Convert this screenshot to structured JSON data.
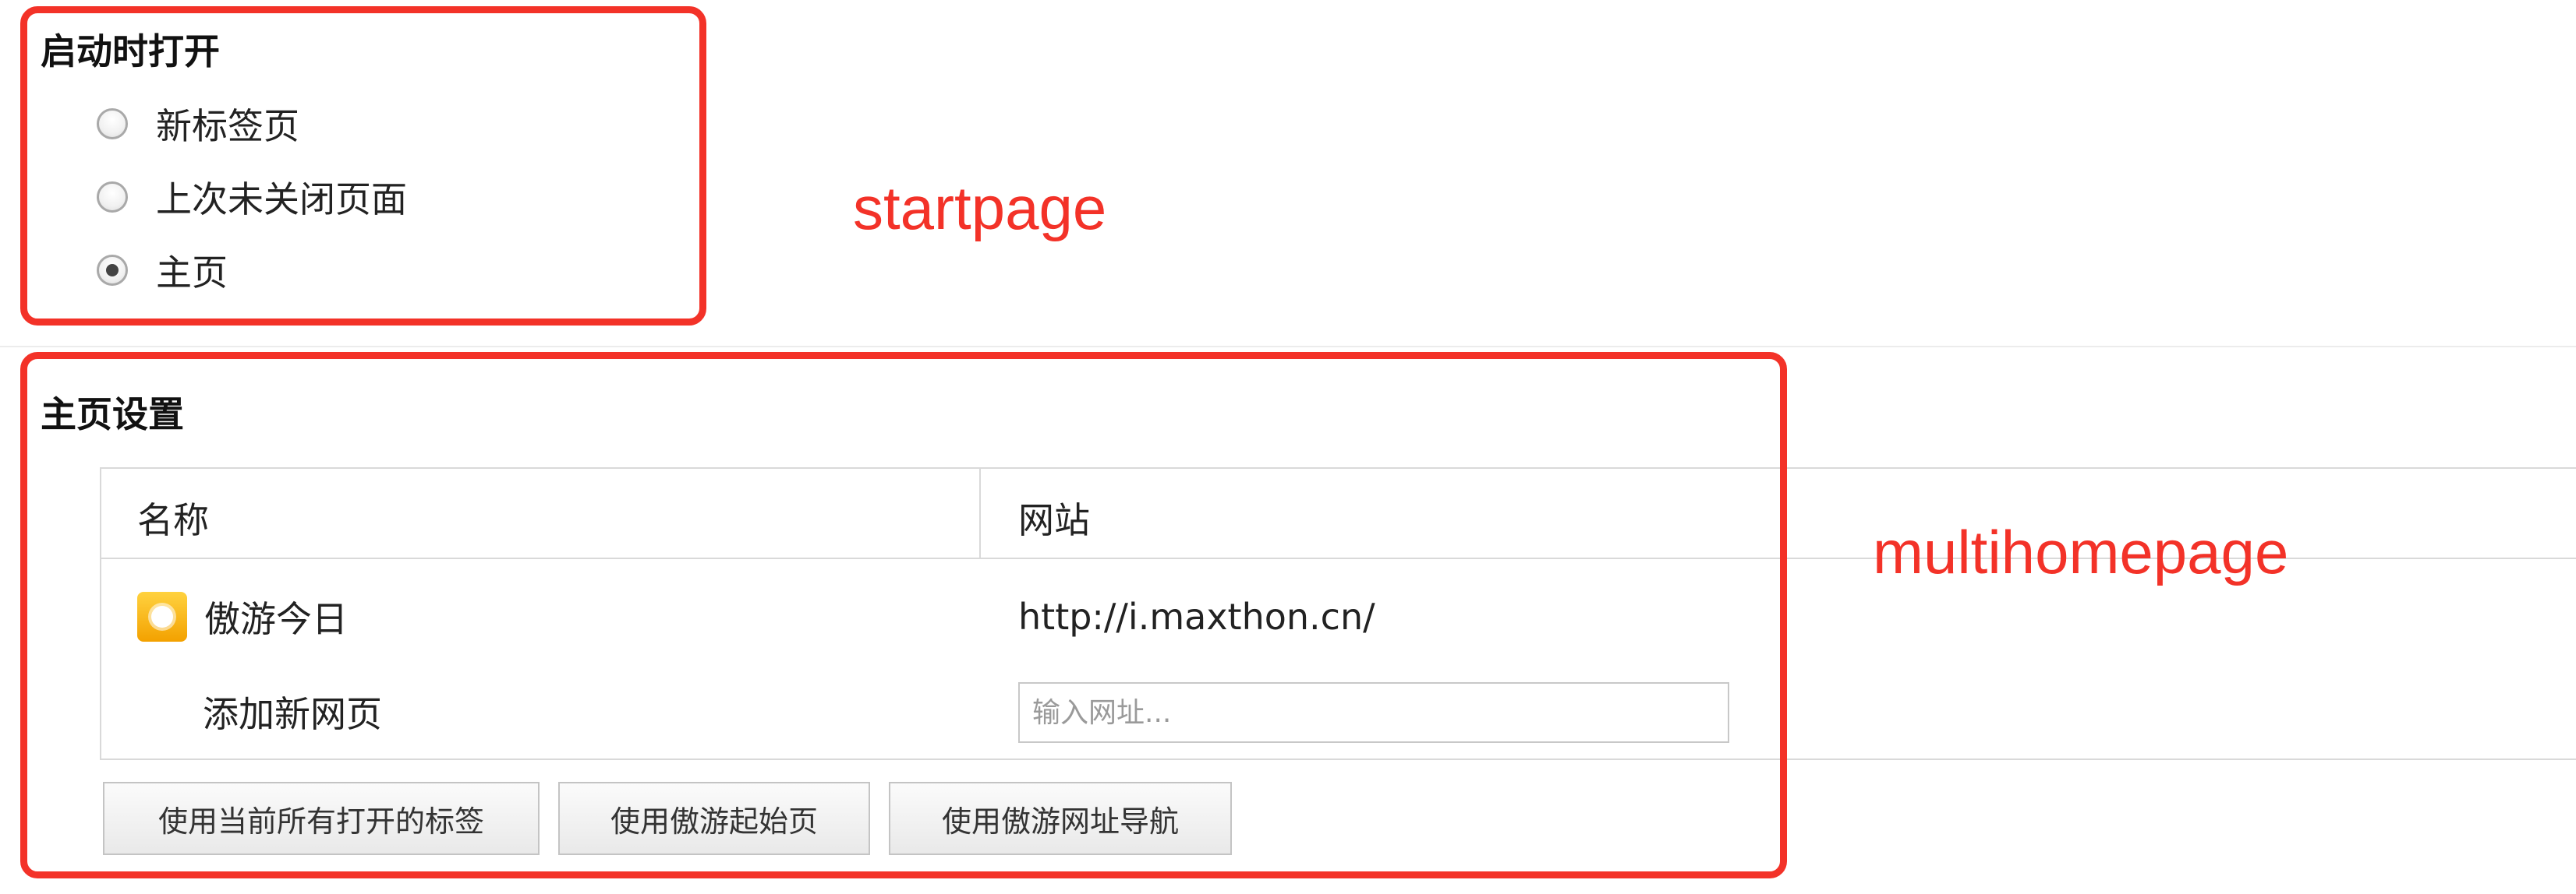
{
  "startup": {
    "title": "启动时打开",
    "options": [
      {
        "label": "新标签页",
        "checked": false
      },
      {
        "label": "上次未关闭页面",
        "checked": false
      },
      {
        "label": "主页",
        "checked": true
      }
    ]
  },
  "homepage": {
    "title": "主页设置",
    "table": {
      "headers": {
        "name": "名称",
        "url": "网站"
      },
      "rows": [
        {
          "name": "傲游今日",
          "url": "http://i.maxthon.cn/",
          "icon": "sun-icon"
        }
      ],
      "add_row": {
        "label": "添加新网页",
        "placeholder": "输入网址..."
      }
    },
    "buttons": {
      "use_current_tabs": "使用当前所有打开的标签",
      "use_maxthon_start": "使用傲游起始页",
      "use_maxthon_nav": "使用傲游网址导航"
    }
  },
  "annotations": {
    "startpage": "startpage",
    "multihomepage": "multihomepage",
    "color": "#f33228"
  }
}
